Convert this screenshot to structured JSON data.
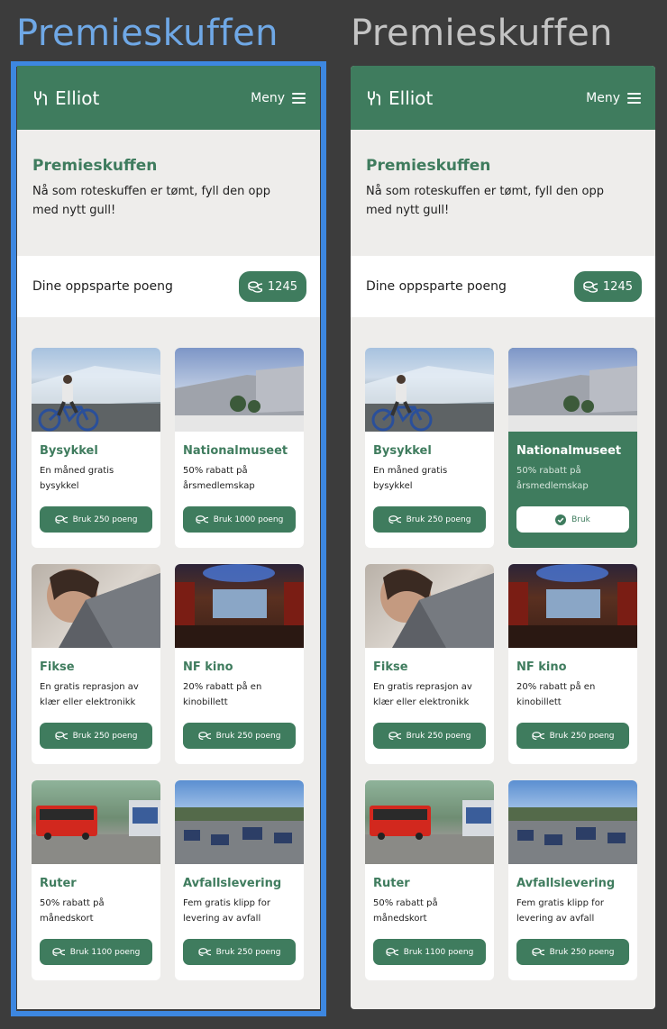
{
  "boards": {
    "left_title": "Premieskuffen",
    "right_title": "Premieskuffen"
  },
  "app": {
    "brand": "Elliot",
    "menu_label": "Meny",
    "accent_color": "#3f7c5e",
    "selection_color": "#3d87e0"
  },
  "intro": {
    "title": "Premieskuffen",
    "text": "Nå som roteskuffen er tømt, fyll den opp med nytt gull!"
  },
  "points": {
    "label": "Dine oppsparte poeng",
    "value": "1245"
  },
  "cards": [
    {
      "title": "Bysykkel",
      "desc": "En måned gratis bysykkel",
      "button": "Bruk 250 poeng",
      "image": "bysykkel-photo"
    },
    {
      "title": "Nationalmuseet",
      "desc": "50% rabatt på årsmedlemskap",
      "button": "Bruk 1000 poeng",
      "image": "nationalmuseet-photo"
    },
    {
      "title": "Fikse",
      "desc": "En gratis reprasjon av klær eller elektronikk",
      "button": "Bruk 250 poeng",
      "image": "fikse-photo"
    },
    {
      "title": "NF kino",
      "desc": "20% rabatt på en kinobillett",
      "button": "Bruk 250 poeng",
      "image": "kino-photo"
    },
    {
      "title": "Ruter",
      "desc": "50% rabatt på månedskort",
      "button": "Bruk 1100 poeng",
      "image": "ruter-photo"
    },
    {
      "title": "Avfallslevering",
      "desc": "Fem gratis klipp for levering av avfall",
      "button": "Bruk 250 poeng",
      "image": "avfall-photo"
    }
  ],
  "active_card": {
    "index": 1,
    "button": "Bruk"
  }
}
